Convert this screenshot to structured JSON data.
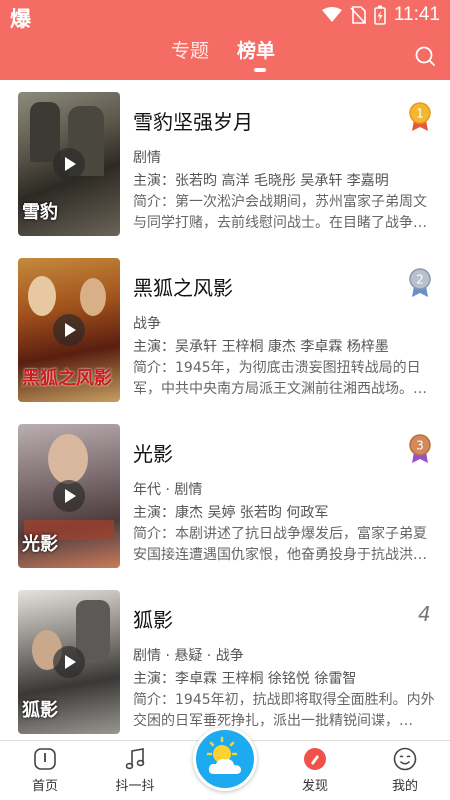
{
  "status_bar": {
    "time": "11:41",
    "app_glyph": "爆"
  },
  "header": {
    "tabs": [
      {
        "label": "专题",
        "active": false
      },
      {
        "label": "榜单",
        "active": true
      }
    ],
    "search_icon": "search-icon",
    "background_color": "#f56c64"
  },
  "list": [
    {
      "title": "雪豹坚强岁月",
      "rank": "1",
      "rank_color": "#f0a21e",
      "genre": "剧情",
      "cast": "主演：张若昀 高洋 毛晓彤 吴承轩 李嘉明",
      "synopsis": "简介：第一次淞沪会战期间，苏州富家子弟周文与同学打赌，去前线慰问战士。在目睹了战争…",
      "poster_caption": "雪豹"
    },
    {
      "title": "黑狐之风影",
      "rank": "2",
      "rank_color": "#9aa4b2",
      "genre": "战争",
      "cast": "主演：吴承轩 王梓桐 康杰 李卓霖 杨梓墨",
      "synopsis": "简介：1945年，为彻底击溃妄图扭转战局的日军，中共中央南方局派王文渊前往湘西战场。…",
      "poster_caption": "黑狐之风影"
    },
    {
      "title": "光影",
      "rank": "3",
      "rank_color": "#c87a4a",
      "genre": "年代 · 剧情",
      "cast": "主演：康杰 吴婷 张若昀 何政军",
      "synopsis": "简介：本剧讲述了抗日战争爆发后，富家子弟夏安国接连遭遇国仇家恨，他奋勇投身于抗战洪…",
      "poster_caption": "光影"
    },
    {
      "title": "狐影",
      "rank": "4",
      "genre": "剧情 · 悬疑 · 战争",
      "cast": "主演：李卓霖 王梓桐 徐铭悦 徐雷智",
      "synopsis": "简介：1945年初，抗战即将取得全面胜利。内外交困的日军垂死挣扎，派出一批精锐间谍，…",
      "poster_caption": "狐影"
    }
  ],
  "bottom_nav": [
    {
      "label": "首页",
      "icon": "home-icon",
      "active": false
    },
    {
      "label": "抖一抖",
      "icon": "music-note-icon",
      "active": false
    },
    {
      "label": "",
      "icon": "weather-icon",
      "active": false
    },
    {
      "label": "发现",
      "icon": "discover-icon",
      "active": true
    },
    {
      "label": "我的",
      "icon": "profile-icon",
      "active": false
    }
  ],
  "accent_color": "#f0524a"
}
